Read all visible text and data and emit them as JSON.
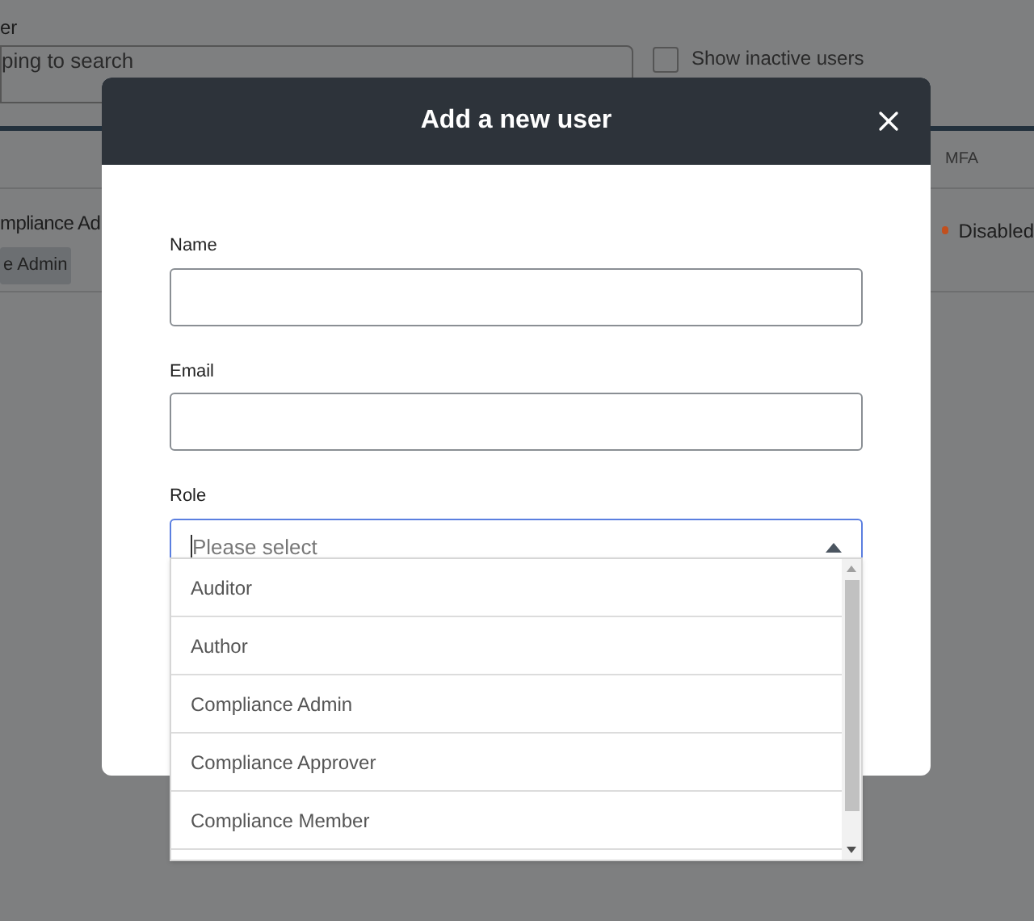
{
  "background": {
    "field_label": "er",
    "search": {
      "placeholder": "ping to search"
    },
    "inactive_toggle": {
      "label": "Show inactive users",
      "checked": false
    },
    "table": {
      "columns": [
        {
          "label": "MFA"
        }
      ],
      "rows": [
        {
          "role": "mpliance Ad",
          "tag": "e Admin",
          "mfa": {
            "label": "Disabled",
            "color": "#c2501e"
          }
        }
      ]
    }
  },
  "dialog": {
    "title": "Add a new user",
    "fields": [
      {
        "label": "Name"
      },
      {
        "label": "Email"
      }
    ],
    "role": {
      "label": "Role",
      "placeholder": "Please select",
      "expanded": true,
      "options": [
        {
          "label": "Auditor"
        },
        {
          "label": "Author"
        },
        {
          "label": "Compliance Admin"
        },
        {
          "label": "Compliance Approver"
        },
        {
          "label": "Compliance Member"
        }
      ]
    }
  }
}
